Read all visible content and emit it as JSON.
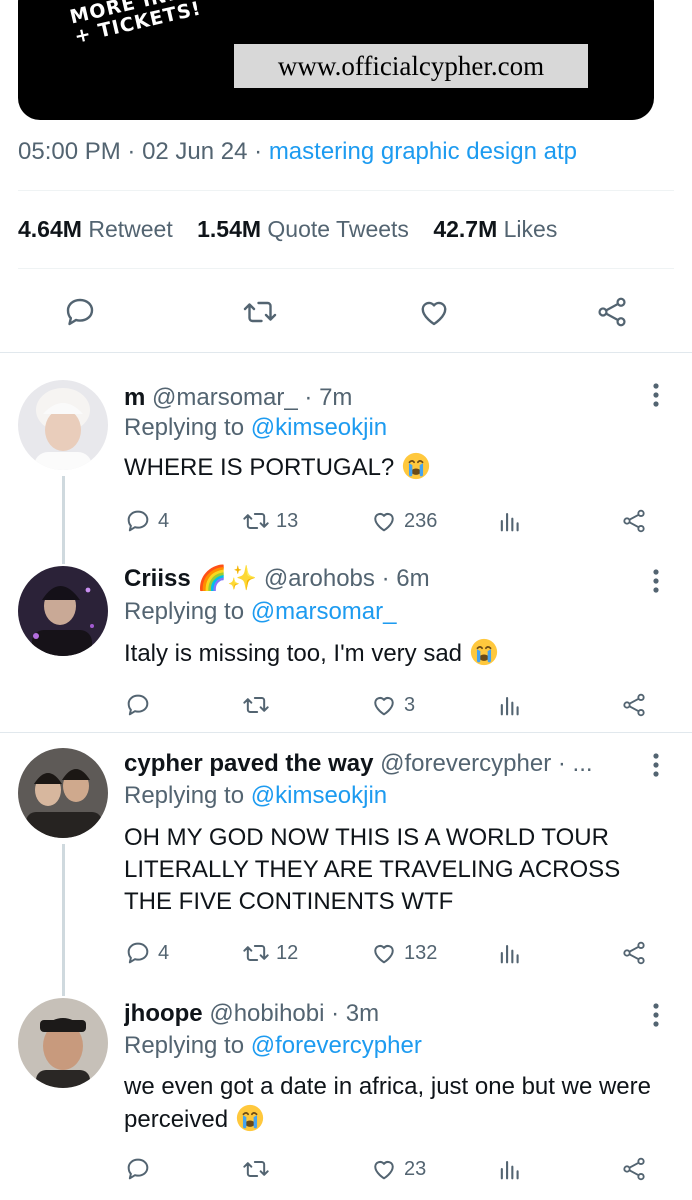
{
  "banner": {
    "promo_text": "MORE INFO\n+ TICKETS!",
    "site_url": "www.officialcypher.com"
  },
  "tweet_meta": {
    "time": "05:00 PM",
    "sep1": " · ",
    "date": "02 Jun 24",
    "sep2": " · ",
    "source": "mastering graphic design atp"
  },
  "stats": [
    {
      "value": "4.64M",
      "label": "Retweet"
    },
    {
      "value": "1.54M",
      "label": "Quote Tweets"
    },
    {
      "value": "42.7M",
      "label": "Likes"
    }
  ],
  "main_actions": [
    "reply-icon",
    "retweet-icon",
    "like-icon",
    "share-icon"
  ],
  "colors": {
    "accent": "#1d9bf0",
    "muted": "#536471",
    "text": "#0f1419",
    "divider": "#eff3f4"
  },
  "replies": [
    {
      "name": "m",
      "handle": "@marsomar_ · 7m",
      "replying_prefix": "Replying to ",
      "replying_to": "@kimseokjin",
      "text": "WHERE IS PORTUGAL?",
      "emoji": "crying-face-emoji",
      "reply_count": "4",
      "retweet_count": "13",
      "like_count": "236"
    },
    {
      "name": "Criiss 🌈✨",
      "handle": "@arohobs · 6m",
      "replying_prefix": "Replying to ",
      "replying_to": "@marsomar_",
      "text": "Italy is missing too, I'm very sad",
      "emoji": "crying-face-emoji",
      "reply_count": "",
      "retweet_count": "",
      "like_count": "3"
    },
    {
      "name": "cypher paved the way",
      "handle": "@forevercypher · ...",
      "replying_prefix": "Replying to ",
      "replying_to": "@kimseokjin",
      "text": "OH MY GOD NOW THIS IS A WORLD TOUR LITERALLY THEY ARE TRAVELING ACROSS THE FIVE CONTINENTS WTF",
      "emoji": "",
      "reply_count": "4",
      "retweet_count": "12",
      "like_count": "132"
    },
    {
      "name": "jhoope",
      "handle": "@hobihobi · 3m",
      "replying_prefix": "Replying to ",
      "replying_to": "@forevercypher",
      "text": "we even got a date in africa, just one but we were perceived",
      "emoji": "crying-face-emoji",
      "reply_count": "",
      "retweet_count": "",
      "like_count": "23"
    }
  ]
}
